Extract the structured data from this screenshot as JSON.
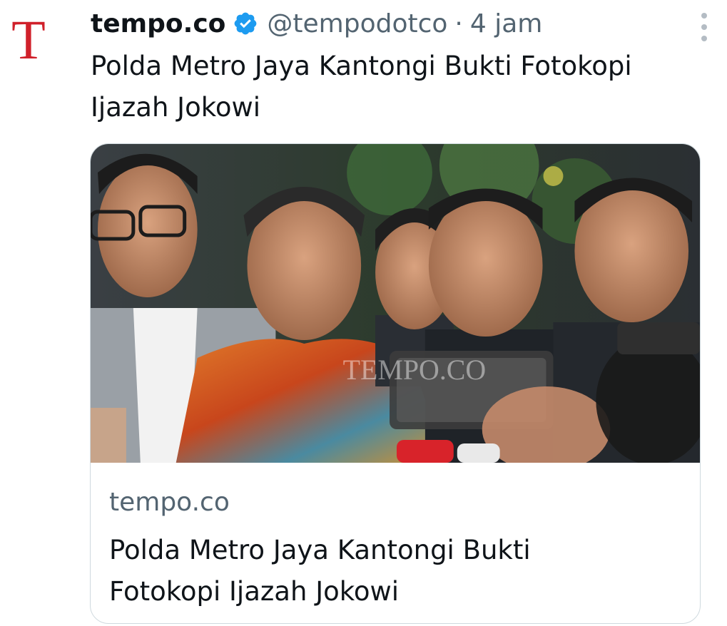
{
  "author": {
    "name": "tempo.co",
    "handle": "@tempodotco",
    "time": "4 jam",
    "avatar_letter": "T",
    "avatar_color": "#d0202a"
  },
  "tweet": {
    "text": "Polda Metro Jaya Kantongi Bukti Fotokopi Ijazah Jokowi"
  },
  "card": {
    "image_watermark": "TEMPO.CO",
    "domain": "tempo.co",
    "title": "Polda Metro Jaya Kantongi Bukti Fotokopi Ijazah Jokowi"
  },
  "icons": {
    "verified": "verified-badge-icon",
    "more": "more-options-icon"
  },
  "colors": {
    "verified": "#1d9bf0",
    "secondary_text": "#536471",
    "border": "#cfd9de"
  }
}
